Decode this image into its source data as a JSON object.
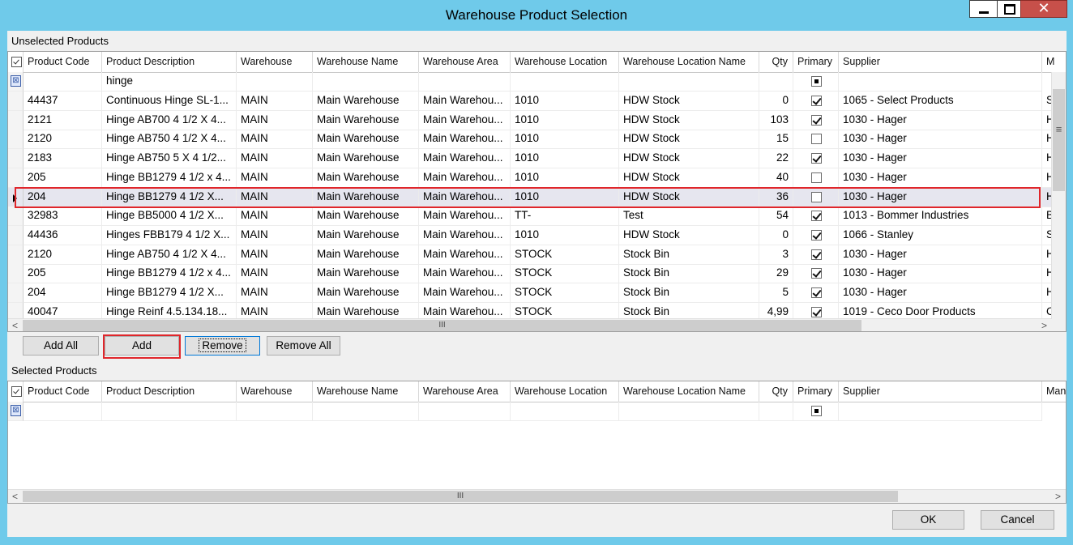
{
  "window": {
    "title": "Warehouse Product Selection",
    "close_glyph": "✕",
    "icons": [
      "minimize-icon",
      "maximize-icon",
      "close-icon"
    ]
  },
  "unselected": {
    "label": "Unselected Products",
    "columns": [
      "Product Code",
      "Product Description",
      "Warehouse",
      "Warehouse Name",
      "Warehouse Area",
      "Warehouse Location",
      "Warehouse Location Name",
      "Qty",
      "Primary",
      "Supplier",
      "M"
    ],
    "filter_description": "hinge",
    "rows": [
      {
        "code": "44437",
        "desc": "Continuous Hinge SL-1...",
        "wh": "MAIN",
        "whname": "Main Warehouse",
        "area": "Main  Warehou...",
        "loc": "1010",
        "locname": "HDW Stock",
        "qty": "0",
        "primary": true,
        "supplier": "1065 - Select Products",
        "m": "S"
      },
      {
        "code": "2121",
        "desc": "Hinge AB700 4 1/2 X 4...",
        "wh": "MAIN",
        "whname": "Main Warehouse",
        "area": "Main  Warehou...",
        "loc": "1010",
        "locname": "HDW Stock",
        "qty": "103",
        "primary": true,
        "supplier": "1030 - Hager",
        "m": "H"
      },
      {
        "code": "2120",
        "desc": "Hinge AB750 4 1/2 X 4...",
        "wh": "MAIN",
        "whname": "Main Warehouse",
        "area": "Main  Warehou...",
        "loc": "1010",
        "locname": "HDW Stock",
        "qty": "15",
        "primary": false,
        "supplier": "1030 - Hager",
        "m": "H"
      },
      {
        "code": "2183",
        "desc": "Hinge AB750 5 X 4 1/2...",
        "wh": "MAIN",
        "whname": "Main Warehouse",
        "area": "Main  Warehou...",
        "loc": "1010",
        "locname": "HDW Stock",
        "qty": "22",
        "primary": true,
        "supplier": "1030 - Hager",
        "m": "H"
      },
      {
        "code": "205",
        "desc": "Hinge BB1279 4 1/2 x 4...",
        "wh": "MAIN",
        "whname": "Main Warehouse",
        "area": "Main  Warehou...",
        "loc": "1010",
        "locname": "HDW Stock",
        "qty": "40",
        "primary": false,
        "supplier": "1030 - Hager",
        "m": "H"
      },
      {
        "code": "204",
        "desc": "Hinge BB1279 4 1/2 X...",
        "wh": "MAIN",
        "whname": "Main Warehouse",
        "area": "Main  Warehou...",
        "loc": "1010",
        "locname": "HDW Stock",
        "qty": "36",
        "primary": false,
        "supplier": "1030 - Hager",
        "m": "H",
        "selected": true
      },
      {
        "code": "32983",
        "desc": "Hinge BB5000 4 1/2 X...",
        "wh": "MAIN",
        "whname": "Main Warehouse",
        "area": "Main  Warehou...",
        "loc": "TT-",
        "locname": "Test",
        "qty": "54",
        "primary": true,
        "supplier": "1013 - Bommer Industries",
        "m": "B"
      },
      {
        "code": "44436",
        "desc": "Hinges FBB179 4 1/2 X...",
        "wh": "MAIN",
        "whname": "Main Warehouse",
        "area": "Main  Warehou...",
        "loc": "1010",
        "locname": "HDW Stock",
        "qty": "0",
        "primary": true,
        "supplier": "1066 - Stanley",
        "m": "S"
      },
      {
        "code": "2120",
        "desc": "Hinge AB750 4 1/2 X 4...",
        "wh": "MAIN",
        "whname": "Main Warehouse",
        "area": "Main  Warehou...",
        "loc": "STOCK",
        "locname": "Stock Bin",
        "qty": "3",
        "primary": true,
        "supplier": "1030 - Hager",
        "m": "H"
      },
      {
        "code": "205",
        "desc": "Hinge BB1279 4 1/2 x 4...",
        "wh": "MAIN",
        "whname": "Main Warehouse",
        "area": "Main  Warehou...",
        "loc": "STOCK",
        "locname": "Stock Bin",
        "qty": "29",
        "primary": true,
        "supplier": "1030 - Hager",
        "m": "H"
      },
      {
        "code": "204",
        "desc": "Hinge BB1279 4 1/2 X...",
        "wh": "MAIN",
        "whname": "Main Warehouse",
        "area": "Main  Warehou...",
        "loc": "STOCK",
        "locname": "Stock Bin",
        "qty": "5",
        "primary": true,
        "supplier": "1030 - Hager",
        "m": "H"
      },
      {
        "code": "40047",
        "desc": "Hinge Reinf 4.5.134.18...",
        "wh": "MAIN",
        "whname": "Main Warehouse",
        "area": "Main  Warehou...",
        "loc": "STOCK",
        "locname": "Stock Bin",
        "qty": "4,99",
        "primary": true,
        "supplier": "1019 - Ceco Door Products",
        "m": "C"
      }
    ],
    "hscroll_thumb": "III",
    "vscroll_thumb": "≡",
    "left_arrow": "<",
    "right_arrow": ">"
  },
  "buttons": {
    "add_all": "Add All",
    "add": "Add",
    "remove": "Remove",
    "remove_all": "Remove All"
  },
  "selected": {
    "label": "Selected Products",
    "columns": [
      "Product Code",
      "Product Description",
      "Warehouse",
      "Warehouse Name",
      "Warehouse Area",
      "Warehouse Location",
      "Warehouse Location Name",
      "Qty",
      "Primary",
      "Supplier",
      "Manu"
    ],
    "hscroll_thumb": "III",
    "left_arrow": "<",
    "right_arrow": ">"
  },
  "footer": {
    "ok": "OK",
    "cancel": "Cancel"
  },
  "icons": {
    "filter": "filter-icon",
    "column_chooser": "column-chooser-icon",
    "current_row": "current-row-arrow-icon"
  }
}
